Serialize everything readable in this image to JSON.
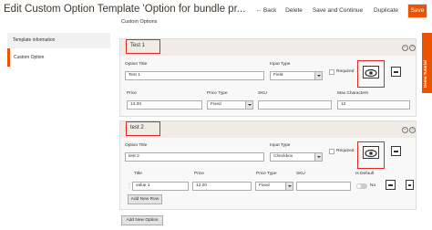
{
  "header": {
    "title": "Edit Custom Option Template 'Option for bundle pr...",
    "back_label": "Back",
    "delete_label": "Delete",
    "save_continue_label": "Save and Continue",
    "duplicate_label": "Duplicate",
    "save_label": "Save"
  },
  "sidebar": {
    "items": [
      {
        "label": "Template information"
      },
      {
        "label": "Custom Option"
      }
    ]
  },
  "right_tab": {
    "label": "Demo Tutorial"
  },
  "main": {
    "section_label": "Custom Options",
    "options": [
      {
        "header_title": "Test 1",
        "option_title_label": "Option Title",
        "option_title_value": "Test 1",
        "input_type_label": "Input Type",
        "input_type_value": "Field",
        "required_label": "Required",
        "price_label": "Price",
        "price_value": "13.00",
        "price_type_label": "Price Type",
        "price_type_value": "Fixed",
        "sku_label": "SKU",
        "sku_value": "",
        "max_chars_label": "Max Characters",
        "max_chars_value": "12"
      },
      {
        "header_title": "test 2",
        "option_title_label": "Option Title",
        "option_title_value": "test 2",
        "input_type_label": "Input Type",
        "input_type_value": "Checkbox",
        "required_label": "Required",
        "rows_headers": [
          "Title",
          "Price",
          "Price Type",
          "SKU",
          "Is Default"
        ],
        "rows": [
          {
            "title": "value 1",
            "price": "12.00",
            "price_type": "Fixed",
            "sku": "",
            "is_default": "No"
          }
        ],
        "add_row_label": "Add New Row"
      }
    ],
    "add_option_label": "Add New Option"
  },
  "colors": {
    "accent": "#eb5202",
    "highlight": "#e22626"
  }
}
